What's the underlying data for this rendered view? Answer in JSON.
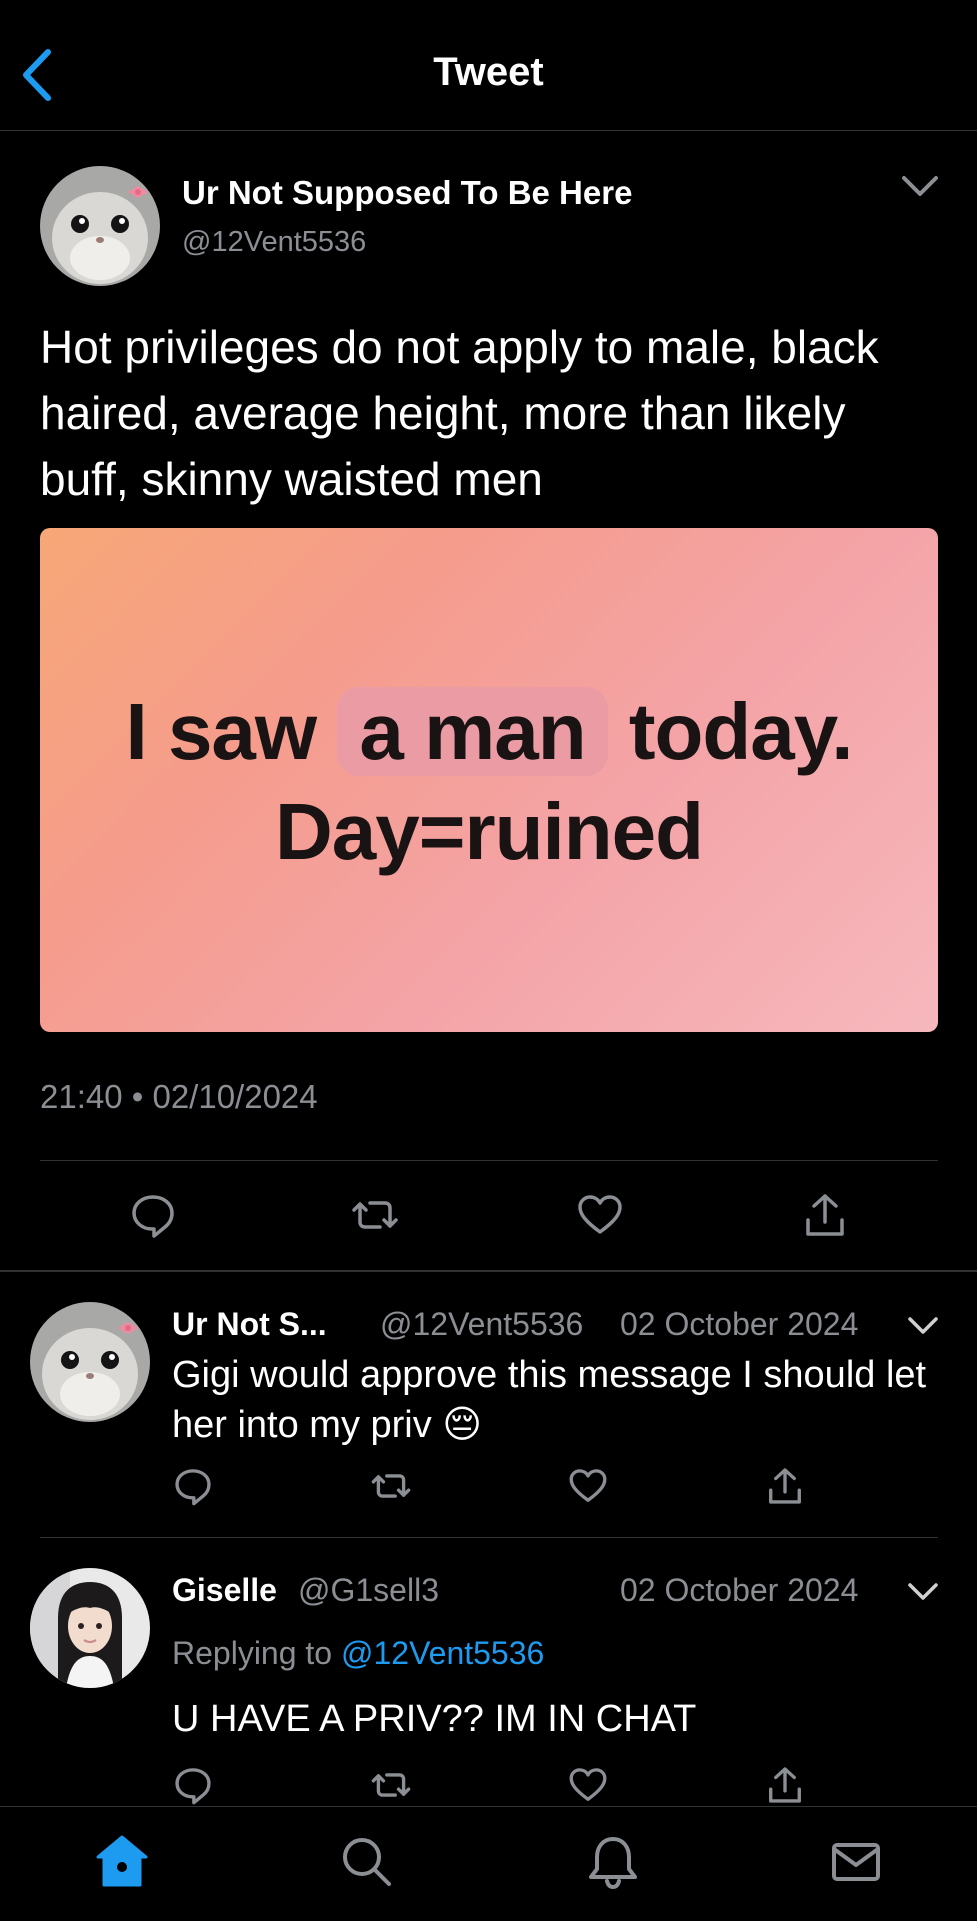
{
  "header": {
    "title": "Tweet"
  },
  "main_tweet": {
    "display_name": "Ur Not Supposed To Be Here",
    "handle": "@12Vent5536",
    "text": "Hot privileges do not apply to male, black haired, average height, more than likely buff, skinny waisted men",
    "media": {
      "line1_before": "I saw",
      "line1_highlight": "a man",
      "line1_after": "today.",
      "line2": "Day=ruined"
    },
    "timestamp": "21:40 • 02/10/2024"
  },
  "replies": [
    {
      "display_name": "Ur Not S...",
      "handle": "@12Vent5536",
      "date": "02 October 2024",
      "text": "Gigi would approve this message I should let her into my priv",
      "emoji": "😔"
    },
    {
      "display_name": "Giselle",
      "handle": "@G1sell3",
      "date": "02 October 2024",
      "replying_prefix": "Replying to",
      "replying_to": "@12Vent5536",
      "text": "U HAVE A PRIV?? IM IN CHAT"
    }
  ],
  "icons": {
    "back": "chevron-left-icon",
    "caret": "chevron-down-icon",
    "reply": "comment-icon",
    "retweet": "retweet-icon",
    "like": "heart-icon",
    "share": "share-icon",
    "tabs": [
      "home-icon",
      "search-icon",
      "bell-icon",
      "mail-icon"
    ]
  },
  "colors": {
    "accent": "#1d9bf0",
    "background": "#000000",
    "muted": "#8b8f94"
  }
}
